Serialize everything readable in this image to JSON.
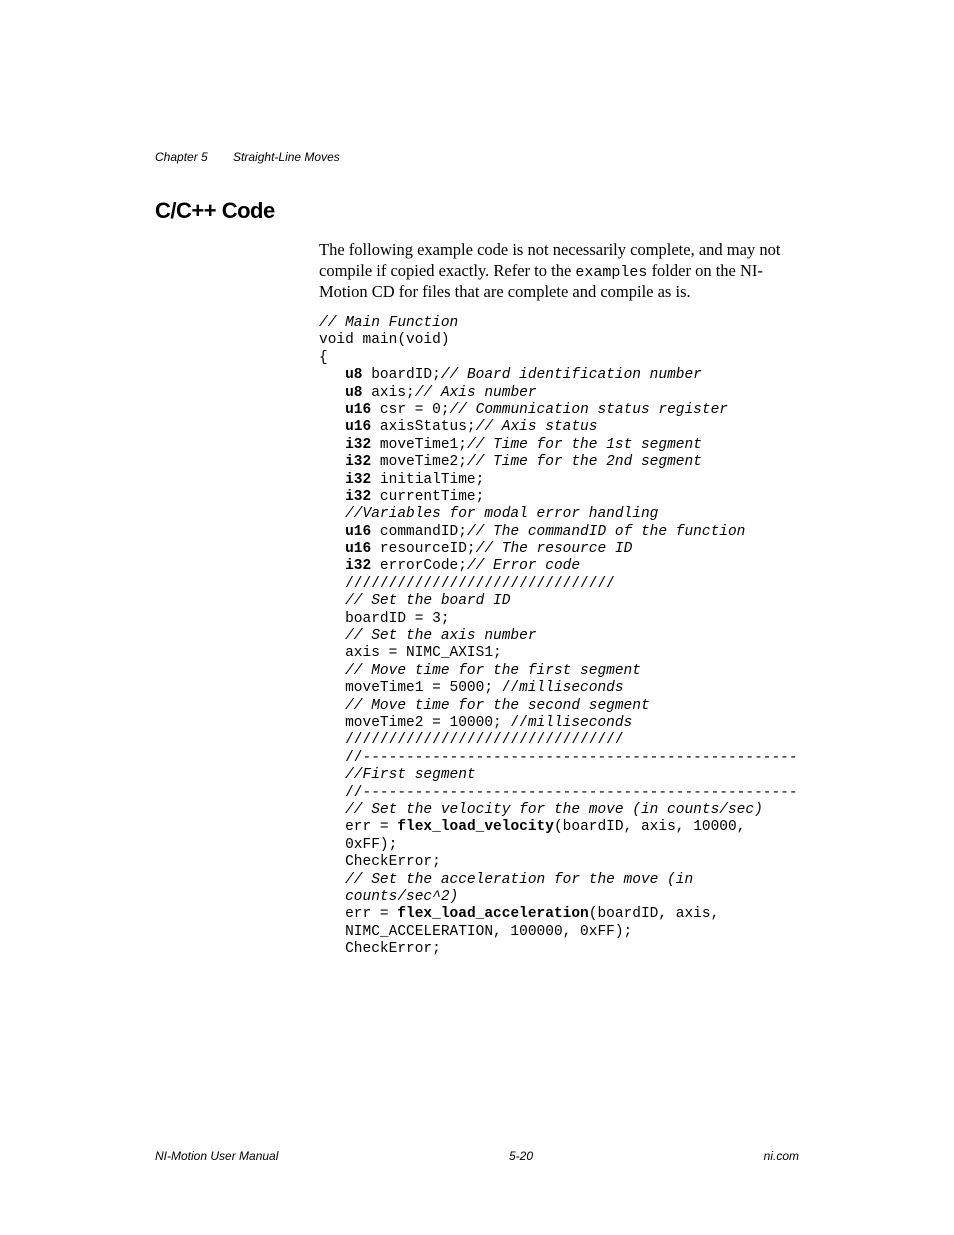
{
  "header": {
    "chapter": "Chapter 5",
    "title": "Straight-Line Moves"
  },
  "heading": "C/C++ Code",
  "intro": {
    "p1a": "The following example code is not necessarily complete, and may not compile if copied exactly. Refer to the ",
    "p1code": "examples",
    "p1b": " folder on the NI-Motion CD for files that are complete and compile as is."
  },
  "code": {
    "l01": "// Main Function",
    "l02": "void main(void)",
    "l03": "{",
    "l04a": "u8",
    "l04b": " boardID;",
    "l04c": "// Board identification number",
    "l05a": "u8",
    "l05b": " axis;",
    "l05c": "// Axis number",
    "l06a": "u16",
    "l06b": " csr = 0;",
    "l06c": "// Communication status register",
    "l07a": "u16",
    "l07b": " axisStatus;",
    "l07c": "// Axis status",
    "l08a": "i32",
    "l08b": " moveTime1;",
    "l08c": "// Time for the 1st segment",
    "l09a": "i32",
    "l09b": " moveTime2;",
    "l09c": "// Time for the 2nd segment",
    "l10a": "i32",
    "l10b": " initialTime;",
    "l11a": "i32",
    "l11b": " currentTime;",
    "l12": "//Variables for modal error handling",
    "l13a": "u16",
    "l13b": " commandID;",
    "l13c": "// The commandID of the function",
    "l14a": "u16",
    "l14b": " resourceID;",
    "l14c": "// The resource ID",
    "l15a": "i32",
    "l15b": " errorCode;",
    "l15c": "// Error code",
    "l16": "///////////////////////////////",
    "l17": "// Set the board ID",
    "l18": "boardID = 3;",
    "l19": "// Set the axis number",
    "l20": "axis = NIMC_AXIS1;",
    "l21": "// Move time for the first segment",
    "l22a": "moveTime1 = 5000; //",
    "l22b": "milliseconds",
    "l23": "// Move time for the second segment",
    "l24a": "moveTime2 = 10000; //",
    "l24b": "milliseconds",
    "l25": "////////////////////////////////",
    "l26": "//--------------------------------------------------",
    "l27": "//First segment",
    "l28": "//--------------------------------------------------",
    "l29": "// Set the velocity for the move (in counts/sec)",
    "l30a": "err = ",
    "l30b": "flex_load_velocity",
    "l30c": "(boardID, axis, 10000, ",
    "l31": "0xFF);",
    "l32": "CheckError;",
    "l33a": "// Set the acceleration for the move (in ",
    "l33b": "counts/sec^2)",
    "l34a": "err = ",
    "l34b": "flex_load_acceleration",
    "l34c": "(boardID, axis, ",
    "l35": "NIMC_ACCELERATION, 100000, 0xFF);",
    "l36": "CheckError;"
  },
  "footer": {
    "left": "NI-Motion User Manual",
    "center": "5-20",
    "right": "ni.com"
  }
}
